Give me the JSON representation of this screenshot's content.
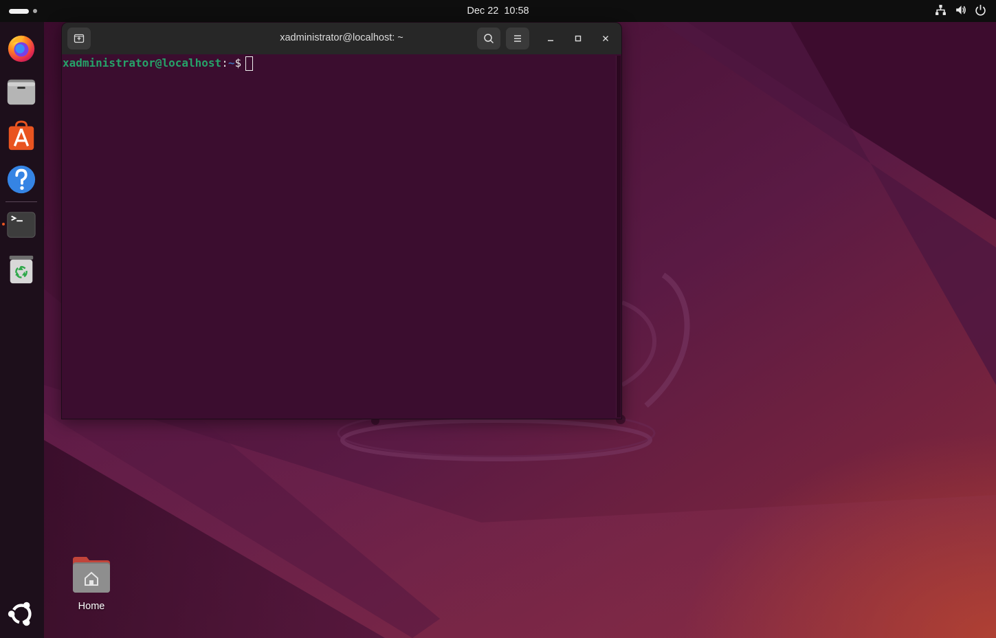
{
  "topbar": {
    "activities": "activities-indicator",
    "date": "Dec 22",
    "time": "10:58",
    "tray_icons": [
      "network-icon",
      "volume-icon",
      "power-icon"
    ]
  },
  "dock": {
    "items": [
      {
        "name": "firefox",
        "icon": "firefox-icon"
      },
      {
        "name": "files",
        "icon": "files-icon"
      },
      {
        "name": "app-center",
        "icon": "app-center-icon"
      },
      {
        "name": "help",
        "icon": "help-icon"
      },
      {
        "name": "terminal",
        "icon": "terminal-icon",
        "running": true
      },
      {
        "name": "trash",
        "icon": "trash-icon"
      },
      {
        "name": "show-apps",
        "icon": "ubuntu-logo-icon"
      }
    ]
  },
  "terminal": {
    "title": "xadministrator@localhost: ~",
    "prompt_user": "xadministrator@localhost",
    "prompt_colon": ":",
    "prompt_path": "~",
    "prompt_symbol": "$"
  },
  "desktop": {
    "home_label": "Home"
  },
  "colors": {
    "accent": "#e95420",
    "terminal_bg": "#3b0d2f",
    "prompt_user": "#26a269",
    "prompt_path": "#3f6db3"
  }
}
